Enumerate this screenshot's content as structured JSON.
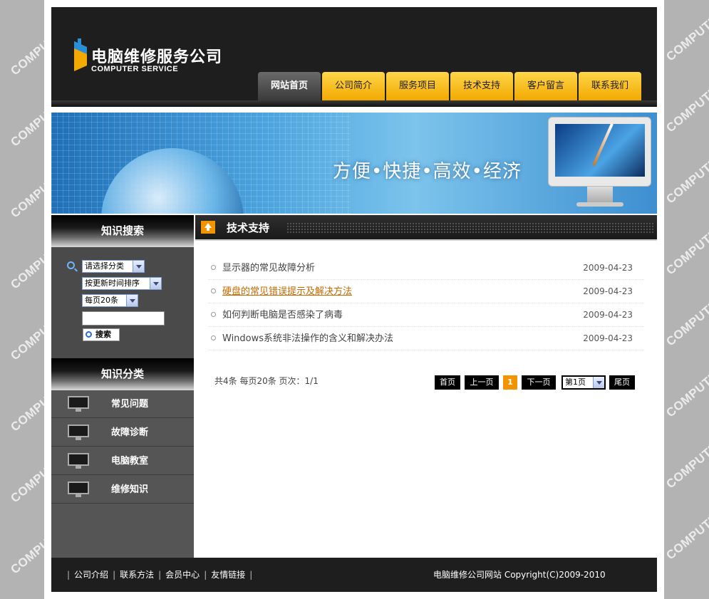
{
  "watermark": "COMPUTER",
  "logo": {
    "cn": "电脑维修服务公司",
    "en": "COMPUTER SERVICE"
  },
  "nav": [
    {
      "label": "网站首页",
      "active": true
    },
    {
      "label": "公司简介"
    },
    {
      "label": "服务项目"
    },
    {
      "label": "技术支持"
    },
    {
      "label": "客户留言"
    },
    {
      "label": "联系我们"
    }
  ],
  "banner": {
    "tagline": "方便•快捷•高效•经济"
  },
  "sidebar": {
    "search_title": "知识搜索",
    "category_select": "请选择分类",
    "sort_select": "按更新时间排序",
    "per_page_select": "每页20条",
    "keyword_value": "",
    "search_button": "搜索",
    "category_title": "知识分类",
    "categories": [
      "常见问题",
      "故障诊断",
      "电脑教室",
      "维修知识"
    ]
  },
  "content": {
    "title": "技术支持",
    "articles": [
      {
        "title": "显示器的常见故障分析",
        "date": "2009-04-23"
      },
      {
        "title": "硬盘的常见错误提示及解决方法",
        "date": "2009-04-23"
      },
      {
        "title": "如何判断电脑是否感染了病毒",
        "date": "2009-04-23"
      },
      {
        "title": "Windows系统非法操作的含义和解决办法",
        "date": "2009-04-23"
      }
    ],
    "pager": {
      "info": "共4条  每页20条  页次：1/1",
      "first": "首页",
      "prev": "上一页",
      "current": "1",
      "next": "下一页",
      "page_select": "第1页",
      "last": "尾页"
    }
  },
  "footer": {
    "links": [
      "公司介绍",
      "联系方法",
      "会员中心",
      "友情链接"
    ],
    "separator": "|",
    "copyright": "电脑维修公司网站  Copyright(C)2009-2010"
  },
  "colors": {
    "accent": "#f29400",
    "nav_tab": "#ffc82a",
    "dark": "#1e1e1e",
    "sidebar": "#555555"
  }
}
